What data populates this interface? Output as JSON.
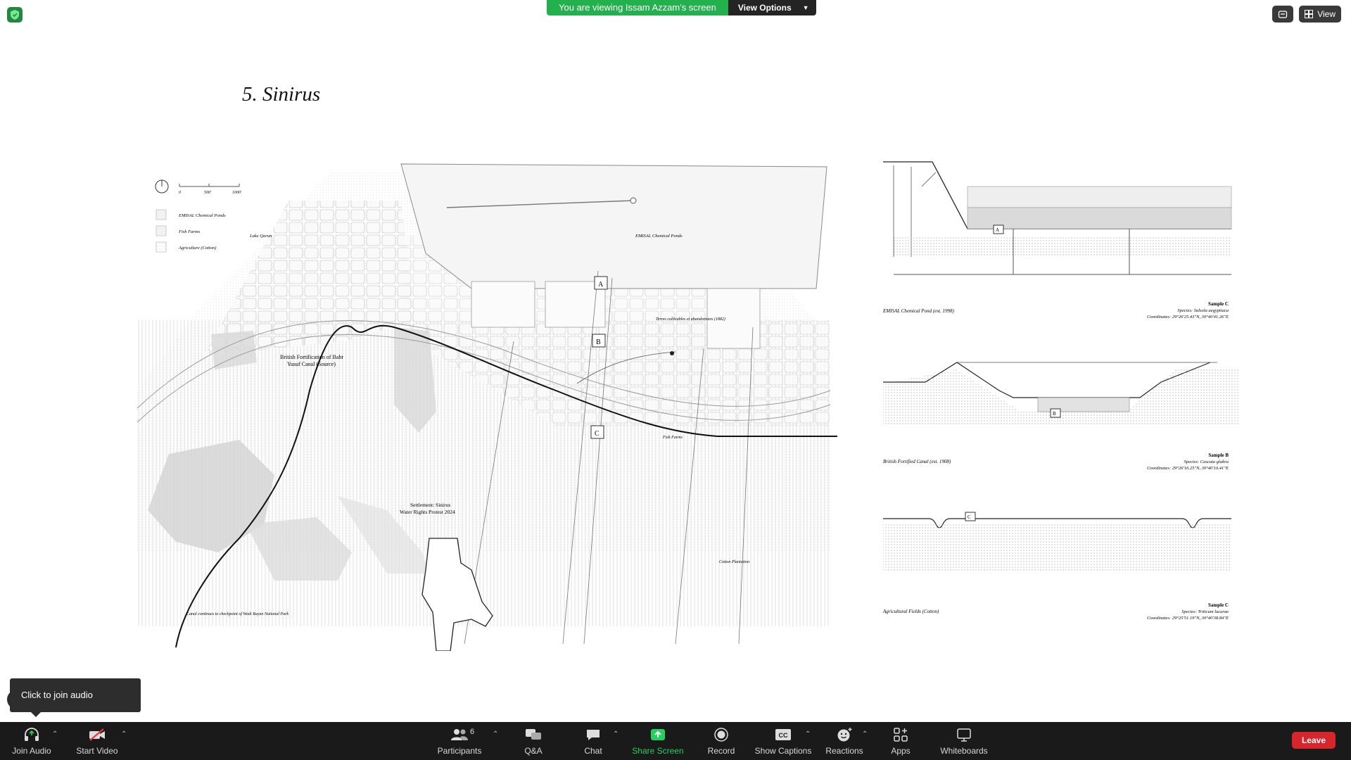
{
  "banner": {
    "viewing_text": "You are viewing Issam Azzam's screen",
    "view_options_label": "View Options"
  },
  "top_right": {
    "view_label": "View"
  },
  "slide": {
    "title": "5. Sinirus",
    "map": {
      "scale_labels": [
        "0",
        "500'",
        "1000'"
      ],
      "legend": [
        "EMISAL Chemical Ponds",
        "Fish Farms",
        "Agriculture (Cotton)"
      ],
      "labels": {
        "lake_qarun": "Lake Qarun",
        "emisal_ponds": "EMISAL Chemical Ponds",
        "british_fort_1": "British Fortification of Bahr",
        "british_fort_2": "Yusuf Canal (Source)",
        "settlement_1": "Settlement: Sinirus",
        "settlement_2": "Water Rights Protest 2024",
        "wadi_canal": "Canal continues to checkpoint of Wadi Rayan National Park",
        "terres": "Terres cultivables et abandonnees (1882)",
        "fish_farms": "Fish Farms",
        "cotton": "Cotton Plantation",
        "marker_a": "A",
        "marker_b": "B",
        "marker_c": "C"
      }
    },
    "sections": {
      "sample_a": {
        "caption": "EMISAL Chemical Pond (est. 1998)",
        "title": "Sample C",
        "species": "Species: Salsola aegyptiaca",
        "coords": "Coordinates: 29°26'25.43\"N, 30°40'41.26\"E",
        "marker": "A"
      },
      "sample_b": {
        "caption": "British Fortified Canal (est. 1908)",
        "title": "Sample B",
        "species": "Species: Cuscuta glabra",
        "coords": "Coordinates: 29°26'16.25\"N, 30°40'10.41\"E",
        "marker": "B"
      },
      "sample_c": {
        "caption": "Agricultural Fields (Cotton)",
        "title": "Sample C",
        "species": "Species: Triticum lucarae",
        "coords": "Coordinates: 29°25'51.19\"N, 30°40'38.84\"E",
        "marker": "C"
      }
    }
  },
  "tooltip": {
    "join_audio_text": "Click to join audio"
  },
  "toolbar": {
    "join_audio": "Join Audio",
    "start_video": "Start Video",
    "participants": "Participants",
    "participants_count": "6",
    "qa": "Q&A",
    "chat": "Chat",
    "share_screen": "Share Screen",
    "record": "Record",
    "show_captions": "Show Captions",
    "reactions": "Reactions",
    "apps": "Apps",
    "whiteboards": "Whiteboards",
    "leave": "Leave"
  },
  "colors": {
    "share_green": "#23b14d",
    "toolbar_bg": "#1a1a1a",
    "leave_red": "#d6262c"
  }
}
